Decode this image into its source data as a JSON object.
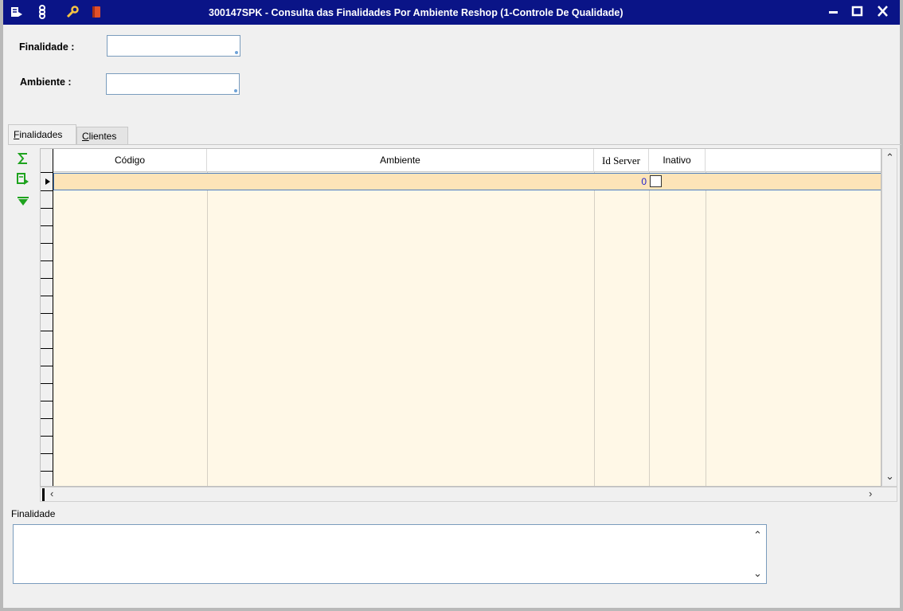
{
  "window": {
    "title": "300147SPK - Consulta das Finalidades Por Ambiente Reshop (1-Controle De Qualidade)",
    "icons": [
      "list-export-icon",
      "stack-icon",
      "wrench-icon",
      "book-icon"
    ],
    "buttons": [
      "minimize-icon",
      "maximize-icon",
      "close-icon"
    ],
    "colors": {
      "titlebar": "#0a1487",
      "selected_row": "#fde4b8",
      "grid_bg": "#fff8e7"
    }
  },
  "filters": {
    "finalidade_label": "Finalidade :",
    "finalidade_value": "",
    "ambiente_label": "Ambiente :",
    "ambiente_value": ""
  },
  "tabs": [
    {
      "label": "Finalidades",
      "accel": "F",
      "active": true
    },
    {
      "label": "Clientes",
      "accel": "C",
      "active": false
    }
  ],
  "side_tools": [
    "sum-icon",
    "export-icon",
    "expand-down-icon"
  ],
  "grid": {
    "columns": [
      "Código",
      "Ambiente",
      "Id Server",
      "Inativo"
    ],
    "rows": [
      {
        "codigo": "",
        "ambiente": "",
        "id_server": "0",
        "inativo": false
      }
    ]
  },
  "memo": {
    "label": "Finalidade",
    "value": ""
  }
}
